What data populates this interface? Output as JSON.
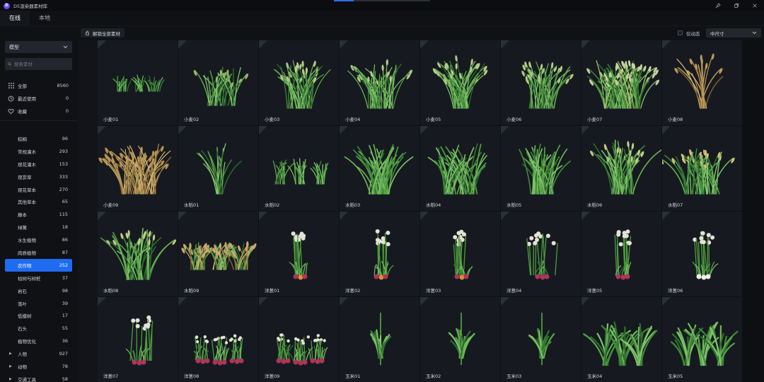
{
  "app": {
    "title": "D5渲染器素材库",
    "logo_letter": "D"
  },
  "tabs": [
    {
      "label": "在线",
      "active": true
    },
    {
      "label": "本地",
      "active": false
    }
  ],
  "window_controls": [
    "pin-icon",
    "restore-icon",
    "close-icon"
  ],
  "sidebar": {
    "type_select": "模型",
    "search_placeholder": "搜索素材",
    "quick": [
      {
        "label": "全部",
        "count": "8560",
        "icon": "grid-icon"
      },
      {
        "label": "最近使用",
        "count": "0",
        "icon": "history-icon"
      },
      {
        "label": "收藏",
        "count": "0",
        "icon": "heart-icon"
      }
    ],
    "categories": [
      {
        "label": "棕榈",
        "count": "96"
      },
      {
        "label": "常规灌木",
        "count": "293"
      },
      {
        "label": "观花灌木",
        "count": "153"
      },
      {
        "label": "观赏草",
        "count": "333"
      },
      {
        "label": "观花草本",
        "count": "270"
      },
      {
        "label": "其他草本",
        "count": "65"
      },
      {
        "label": "藤本",
        "count": "115"
      },
      {
        "label": "绿篱",
        "count": "18"
      },
      {
        "label": "水生植物",
        "count": "86"
      },
      {
        "label": "肉质植物",
        "count": "87"
      },
      {
        "label": "农作物",
        "count": "252",
        "active": true
      },
      {
        "label": "枯树与树桩",
        "count": "37"
      },
      {
        "label": "岩石",
        "count": "98"
      },
      {
        "label": "落叶",
        "count": "39"
      },
      {
        "label": "低模树",
        "count": "17"
      },
      {
        "label": "石头",
        "count": "55"
      },
      {
        "label": "植物优化",
        "count": "36"
      },
      {
        "label": "人物",
        "count": "927",
        "parent": true
      },
      {
        "label": "动物",
        "count": "78",
        "parent": true
      },
      {
        "label": "交通工具",
        "count": "58",
        "parent": true
      }
    ]
  },
  "toolbar": {
    "unlock_label": "解锁全部素材",
    "anim_only_label": "仅动态",
    "size_select": "中尺寸"
  },
  "colors": {
    "accent": "#1f6cf2",
    "background": "#0d0f13",
    "card": "#161a20"
  },
  "assets": [
    {
      "name": "小麦01",
      "kind": "wheat-small"
    },
    {
      "name": "小麦02",
      "kind": "wheat-bush"
    },
    {
      "name": "小麦03",
      "kind": "wheat"
    },
    {
      "name": "小麦04",
      "kind": "wheat"
    },
    {
      "name": "小麦05",
      "kind": "wheat-tall"
    },
    {
      "name": "小麦06",
      "kind": "wheat"
    },
    {
      "name": "小麦07",
      "kind": "wheat-dense"
    },
    {
      "name": "小麦08",
      "kind": "wheat-dry-thin"
    },
    {
      "name": "小麦09",
      "kind": "wheat-dry"
    },
    {
      "name": "水稻01",
      "kind": "rice-thin"
    },
    {
      "name": "水稻02",
      "kind": "rice-small"
    },
    {
      "name": "水稻03",
      "kind": "rice"
    },
    {
      "name": "水稻04",
      "kind": "rice-wide"
    },
    {
      "name": "水稻05",
      "kind": "rice"
    },
    {
      "name": "水稻06",
      "kind": "rice-seed"
    },
    {
      "name": "水稻07",
      "kind": "rice-golden"
    },
    {
      "name": "水稻08",
      "kind": "rice-seed"
    },
    {
      "name": "水稻09",
      "kind": "rice-row"
    },
    {
      "name": "洋葱01",
      "kind": "onion"
    },
    {
      "name": "洋葱02",
      "kind": "onion"
    },
    {
      "name": "洋葱03",
      "kind": "onion"
    },
    {
      "name": "洋葱04",
      "kind": "onion-spread"
    },
    {
      "name": "洋葱05",
      "kind": "onion-tall"
    },
    {
      "name": "洋葱06",
      "kind": "onion-white"
    },
    {
      "name": "洋葱07",
      "kind": "onion-spread"
    },
    {
      "name": "洋葱08",
      "kind": "onion-cluster"
    },
    {
      "name": "洋葱09",
      "kind": "onion-cluster"
    },
    {
      "name": "玉米01",
      "kind": "corn"
    },
    {
      "name": "玉米02",
      "kind": "corn"
    },
    {
      "name": "玉米03",
      "kind": "corn"
    },
    {
      "name": "玉米04",
      "kind": "corn-row"
    },
    {
      "name": "玉米05",
      "kind": "corn-row"
    }
  ]
}
